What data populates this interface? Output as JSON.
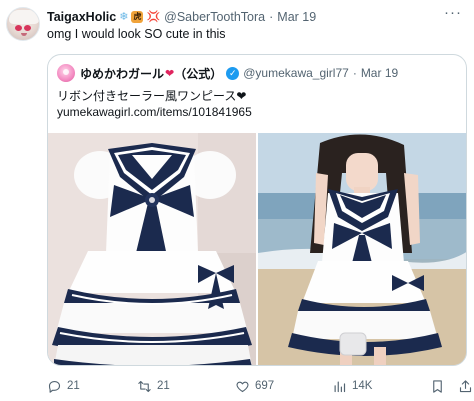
{
  "tweet": {
    "display_name": "TaigaxHolic",
    "name_emojis": [
      "❄",
      "虎",
      "💢"
    ],
    "handle": "@SaberToothTora",
    "separator": "·",
    "timestamp": "Mar 19",
    "text": "omg I would look SO cute in this",
    "more_label": "···"
  },
  "quoted": {
    "display_name": "ゆめかわガール",
    "heart": "❤",
    "name_suffix": "（公式）",
    "verified_mark": "✓",
    "handle": "@yumekawa_girl77",
    "separator": "·",
    "timestamp": "Mar 19",
    "text": "リボン付きセーラー風ワンピース❤",
    "link": "yumekawagirl.com/items/101841965"
  },
  "actions": {
    "reply_count": "21",
    "retweet_count": "21",
    "like_count": "697",
    "view_count": "14K"
  },
  "icons": {
    "reply": "reply-icon",
    "retweet": "retweet-icon",
    "like": "heart-icon",
    "views": "views-chart-icon",
    "bookmark": "bookmark-icon",
    "share": "share-icon",
    "verified": "verified-badge-icon"
  },
  "colors": {
    "text_primary": "#0f1419",
    "text_secondary": "#536471",
    "verified_blue": "#1d9bf0",
    "border": "#cfd9de",
    "heart_red": "#e0245e",
    "dress_navy": "#1b2a4e"
  }
}
